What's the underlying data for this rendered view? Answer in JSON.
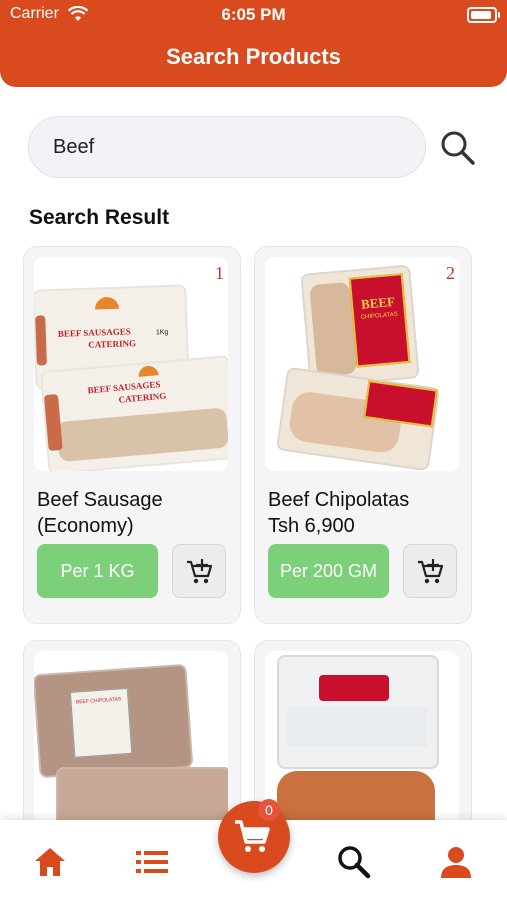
{
  "status_bar": {
    "carrier": "Carrier",
    "time": "6:05 PM"
  },
  "header": {
    "title": "Search Products"
  },
  "search": {
    "value": "Beef",
    "placeholder": ""
  },
  "results": {
    "title": "Search Result",
    "items": [
      {
        "rank": "1",
        "name": "Beef Sausage (Economy)",
        "unit": "Per  1 KG",
        "pack_text_top": "BEEF SAUSAGES",
        "pack_text_bottom": "CATERING",
        "weight": "1Kg"
      },
      {
        "rank": "2",
        "name": "Beef Chipolatas\nTsh 6,900",
        "unit": "Per  200 GM",
        "pack_text_top": "BEEF",
        "pack_text_bottom": "CHIPOLATAS"
      },
      {
        "rank": "",
        "name": "",
        "unit": "",
        "pack_text_top": "BEEF CHIPOLATAS"
      },
      {
        "rank": "",
        "name": "",
        "unit": ""
      }
    ]
  },
  "nav": {
    "cart_count": "0"
  },
  "colors": {
    "primary": "#d94a1e",
    "unit_button": "#7dd07a",
    "rank": "#c0392b"
  }
}
